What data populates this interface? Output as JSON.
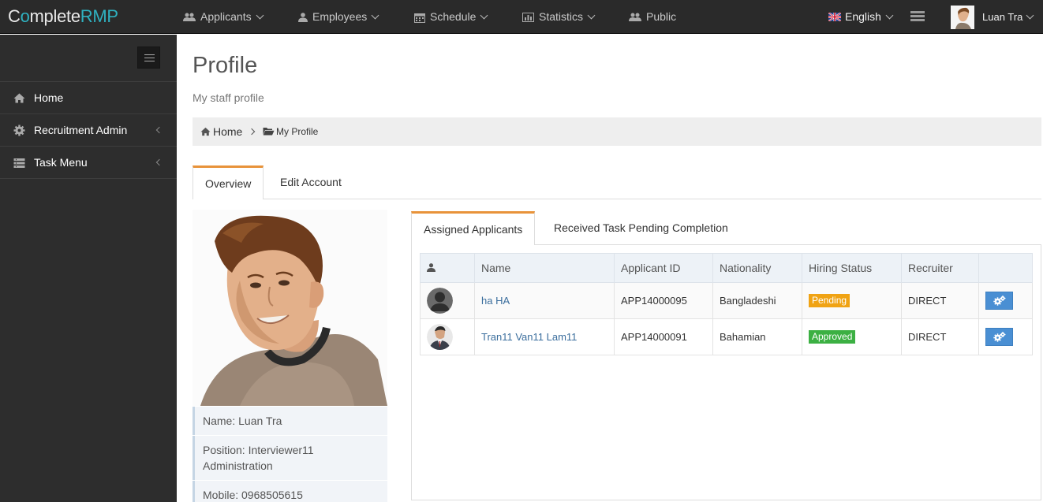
{
  "brand": {
    "prefix": "C",
    "o": "o",
    "middle": "mplete",
    "accent": "RMP"
  },
  "nav": {
    "applicants": "Applicants",
    "employees": "Employees",
    "schedule": "Schedule",
    "statistics": "Statistics",
    "public": "Public",
    "language": "English",
    "user_name": "Luan Tra"
  },
  "sidebar": {
    "items": [
      {
        "label": "Home",
        "icon": "home-icon"
      },
      {
        "label": "Recruitment Admin",
        "icon": "gear-icon"
      },
      {
        "label": "Task Menu",
        "icon": "list-icon"
      }
    ]
  },
  "page": {
    "title": "Profile",
    "subtitle": "My staff profile"
  },
  "breadcrumb": {
    "home": "Home",
    "current": "My Profile"
  },
  "tabs": {
    "overview": "Overview",
    "edit_account": "Edit Account"
  },
  "profile": {
    "name": "Name: Luan Tra",
    "position": "Position: Interviewer11 Administration",
    "mobile": "Mobile: 0968505615"
  },
  "inner_tabs": {
    "assigned": "Assigned Applicants",
    "received": "Received Task Pending Completion"
  },
  "table": {
    "headers": [
      "",
      "Name",
      "Applicant ID",
      "Nationality",
      "Hiring Status",
      "Recruiter",
      ""
    ],
    "rows": [
      {
        "name": "ha HA",
        "id": "APP14000095",
        "nationality": "Bangladeshi",
        "status": "Pending",
        "recruiter": "DIRECT"
      },
      {
        "name": "Tran11 Van11 Lam11",
        "id": "APP14000091",
        "nationality": "Bahamian",
        "status": "Approved",
        "recruiter": "DIRECT"
      }
    ]
  },
  "colors": {
    "accent": "#e8933a",
    "brand": "#2fb1c0",
    "pending": "#f0a314",
    "approved": "#3cb043",
    "button": "#4a8fd3"
  }
}
